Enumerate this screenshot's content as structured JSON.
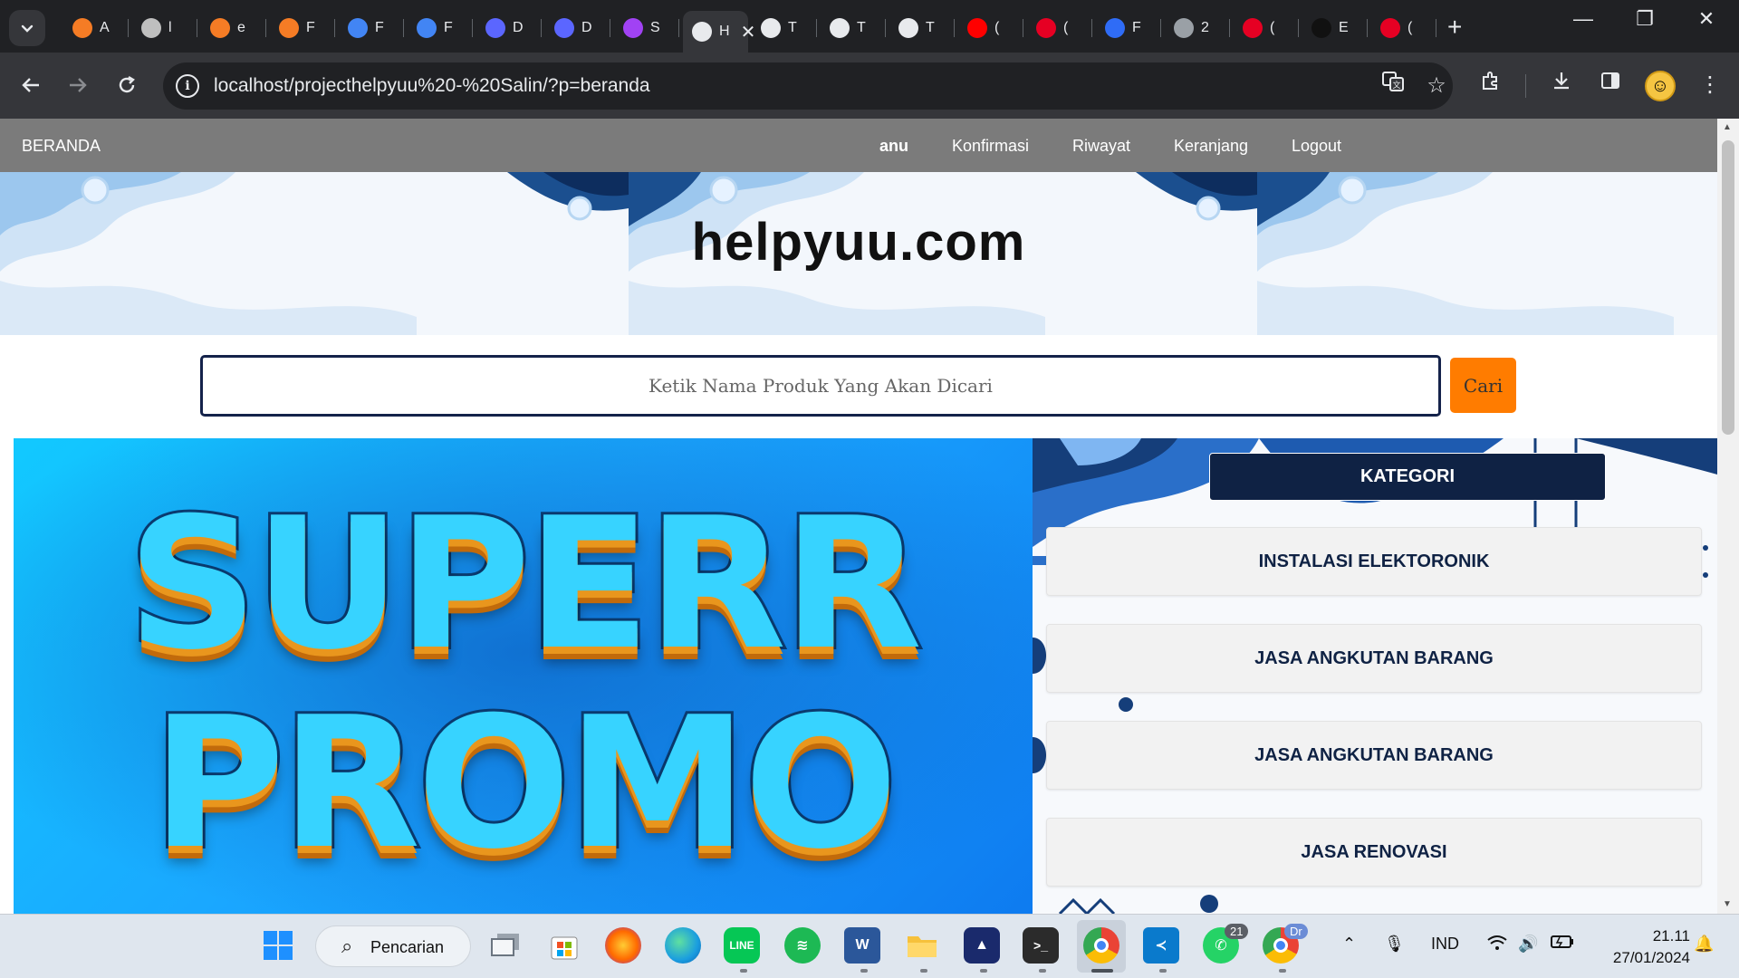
{
  "browser": {
    "tabs": [
      {
        "letter": "A",
        "color": "#f57c25"
      },
      {
        "letter": "l",
        "color": "#bfbfbf"
      },
      {
        "letter": "e",
        "color": "#f57c25"
      },
      {
        "letter": "F",
        "color": "#f57c25"
      },
      {
        "letter": "F",
        "color": "#4285f4"
      },
      {
        "letter": "F",
        "color": "#4285f4"
      },
      {
        "letter": "D",
        "color": "#5b66ff"
      },
      {
        "letter": "D",
        "color": "#5b66ff"
      },
      {
        "letter": "S",
        "color": "#a142f4"
      },
      {
        "letter": "H",
        "color": "#e8eaed",
        "active": true
      },
      {
        "letter": "T",
        "color": "#e8eaed"
      },
      {
        "letter": "T",
        "color": "#e8eaed"
      },
      {
        "letter": "T",
        "color": "#e8eaed"
      },
      {
        "letter": "(",
        "color": "#ff0000"
      },
      {
        "letter": "(",
        "color": "#e60023"
      },
      {
        "letter": "F",
        "color": "#2f6cf6"
      },
      {
        "letter": "2",
        "color": "#9aa0a6"
      },
      {
        "letter": "(",
        "color": "#e60023"
      },
      {
        "letter": "E",
        "color": "#111111"
      },
      {
        "letter": "(",
        "color": "#e60023"
      }
    ],
    "url": "localhost/projecthelpyuu%20-%20Salin/?p=beranda"
  },
  "site": {
    "nav": {
      "brand": "BERANDA",
      "items": [
        "anu",
        "Konfirmasi",
        "Riwayat",
        "Keranjang",
        "Logout"
      ]
    },
    "title": "helpyuu.com",
    "search": {
      "placeholder": "Ketik Nama Produk Yang Akan Dicari",
      "button": "Cari"
    },
    "promo": {
      "line1": "SUPERR",
      "line2": "PROMO"
    },
    "categories": {
      "heading": "KATEGORI",
      "items": [
        "INSTALASI ELEKTORONIK",
        "JASA ANGKUTAN BARANG",
        "JASA ANGKUTAN BARANG",
        "JASA RENOVASI"
      ]
    }
  },
  "taskbar": {
    "search_label": "Pencarian",
    "language": "IND",
    "time": "21.11",
    "date": "27/01/2024",
    "whatsapp_badge": "21",
    "chrome_profile_badge": "Dr"
  },
  "colors": {
    "nav_bg": "#7b7b7b",
    "search_button": "#ff7c00",
    "category_header": "#0f2244"
  }
}
